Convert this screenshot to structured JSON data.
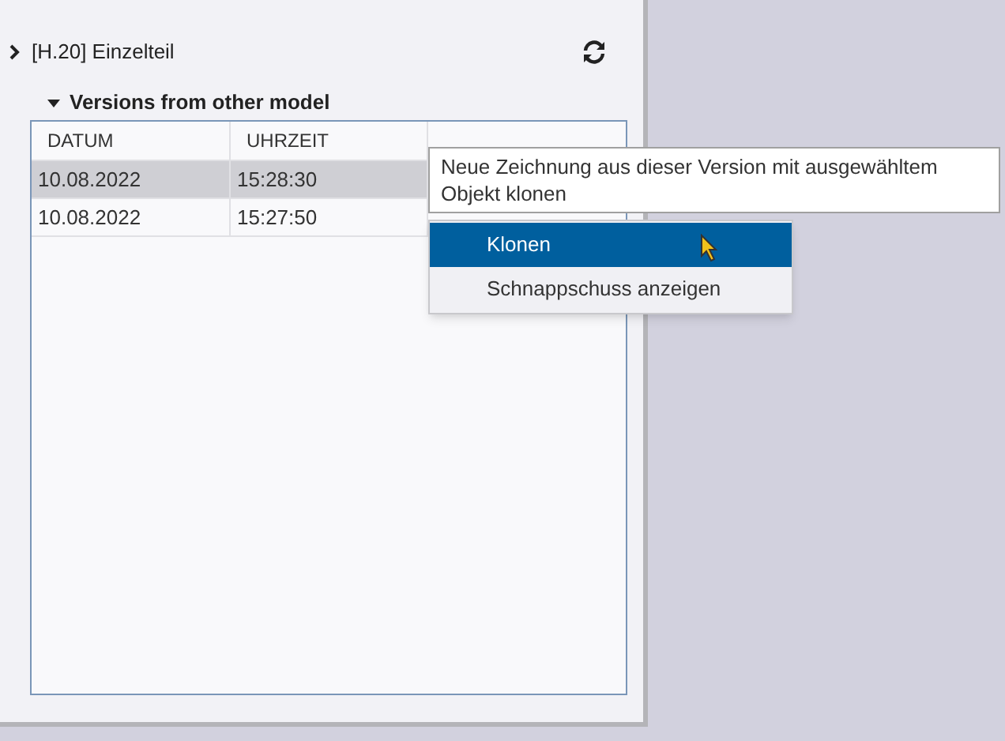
{
  "tree_item": {
    "label": "[H.20] Einzelteil",
    "expanded": false
  },
  "section": {
    "title": "Versions from other model",
    "expanded": true
  },
  "table": {
    "columns": [
      "DATUM",
      "UHRZEIT"
    ],
    "rows": [
      {
        "cells": [
          "10.08.2022",
          "15:28:30"
        ],
        "selected": true
      },
      {
        "cells": [
          "10.08.2022",
          "15:27:50"
        ],
        "selected": false
      }
    ]
  },
  "tooltip": "Neue Zeichnung aus dieser Version mit ausgewähltem Objekt klonen",
  "context_menu": [
    {
      "label": "Klonen",
      "selected": true
    },
    {
      "label": "Schnappschuss anzeigen",
      "selected": false
    }
  ]
}
